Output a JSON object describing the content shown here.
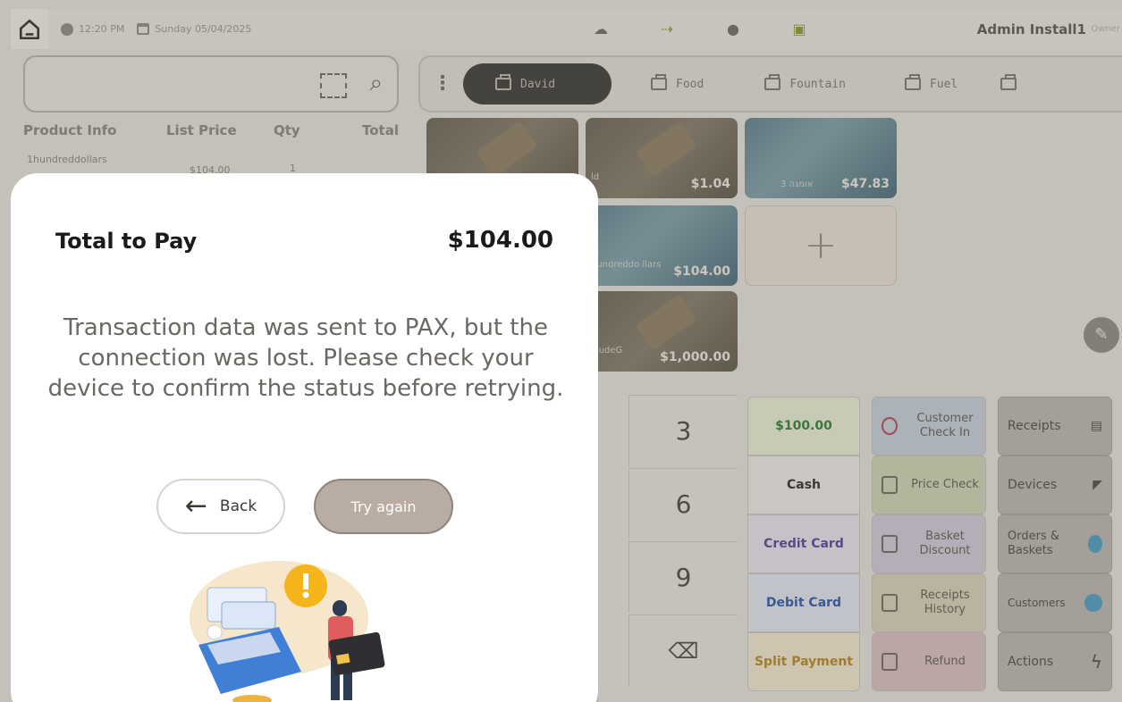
{
  "topbar": {
    "time": "12:20 PM",
    "date": "Sunday 05/04/2025",
    "user_name": "Admin Install1",
    "user_role": "Owner"
  },
  "cart": {
    "columns": [
      "Product Info",
      "List Price",
      "Qty",
      "Total"
    ],
    "rows": [
      {
        "name": "1hundreddollars",
        "price": "$104.00",
        "qty": "1"
      }
    ]
  },
  "categories": {
    "tabs": [
      "David",
      "Food",
      "Fountain",
      "Fuel"
    ]
  },
  "products": [
    {
      "name": "",
      "price": ""
    },
    {
      "name": "ld",
      "price": "$1.04"
    },
    {
      "name": "3 אומגה",
      "price": "$47.83"
    },
    {
      "name": "hundreddo llars",
      "price": "$104.00"
    },
    {
      "name": "xludeG",
      "price": "$1,000.00"
    }
  ],
  "keypad": {
    "keys": [
      "3",
      "6",
      "9"
    ]
  },
  "payments": [
    "$100.00",
    "Cash",
    "Credit Card",
    "Debit Card",
    "Split Payment"
  ],
  "functions": [
    "Customer Check In",
    "Price Check",
    "Basket Discount",
    "Receipts History",
    "Refund"
  ],
  "side_actions": [
    "Receipts",
    "Devices",
    "Orders & Baskets",
    "Customers",
    "Actions"
  ],
  "modal": {
    "title": "Total to Pay",
    "amount": "$104.00",
    "message": "Transaction data was sent to PAX, but the connection was lost. Please check your device to confirm the status before retrying.",
    "back_label": "Back",
    "retry_label": "Try again"
  },
  "colors": {
    "accent_dark": "#3a3834",
    "retry_button": "#b8aca3",
    "payment_green": "#2e7d32",
    "payment_purple": "#5b3f99",
    "payment_blue": "#2a57a8",
    "split_gold": "#b58a1c"
  }
}
